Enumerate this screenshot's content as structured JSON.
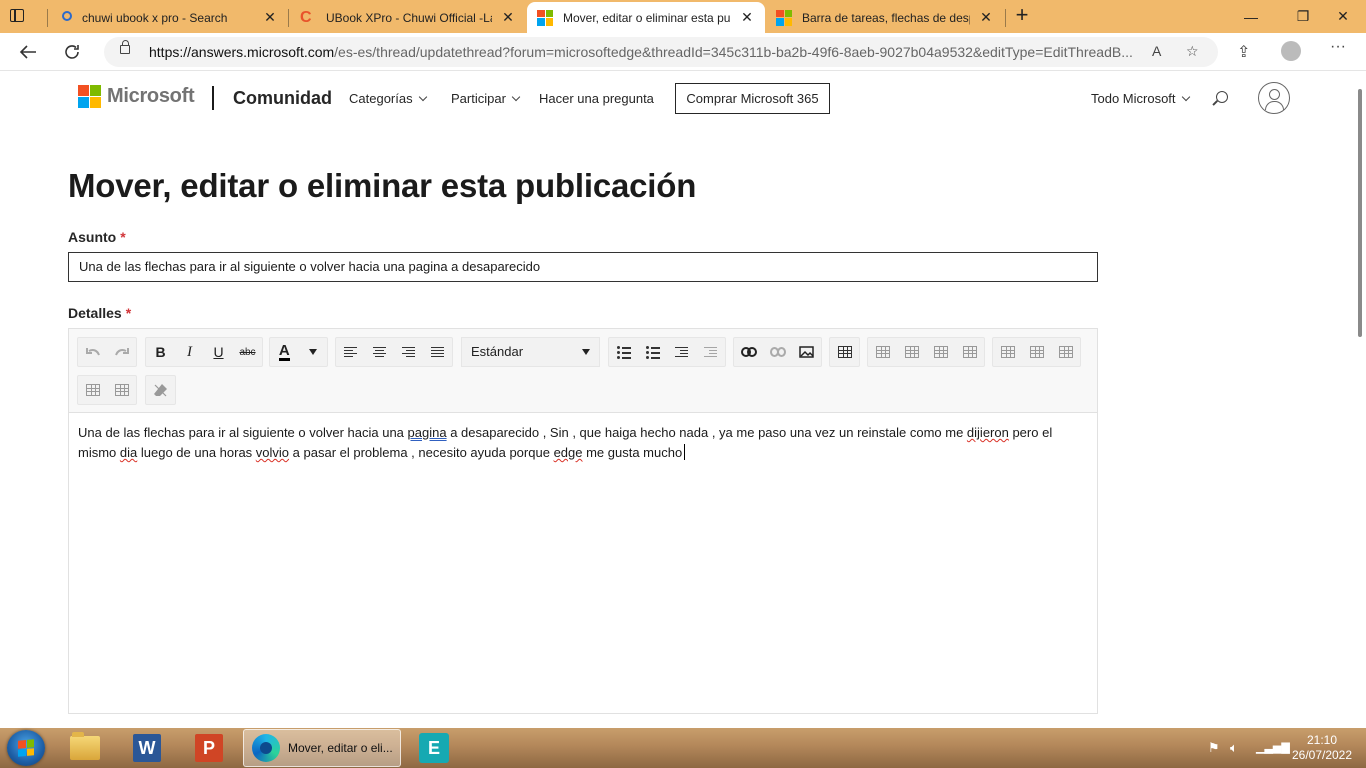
{
  "browser": {
    "tabs": [
      {
        "title": "chuwi ubook x pro - Search",
        "icon": "search-icon"
      },
      {
        "title": "UBook XPro - Chuwi Official -Lap",
        "icon": "chuwi-icon"
      },
      {
        "title": "Mover, editar o eliminar esta pub",
        "icon": "microsoft-logo-icon",
        "active": true
      },
      {
        "title": "Barra de tareas, flechas de despl",
        "icon": "microsoft-logo-icon"
      }
    ],
    "url_host": "https://answers.microsoft.com",
    "url_rest": "/es-es/thread/updatethread?forum=microsoftedge&threadId=345c311b-ba2b-49f6-8aeb-9027b04a9532&editType=EditThreadB...",
    "read_aloud": "A",
    "window_controls": {
      "minimize": "—",
      "restore": "❐",
      "close": "✕"
    }
  },
  "header": {
    "brand": "Microsoft",
    "community": "Comunidad",
    "nav": {
      "categorias": "Categorías",
      "participar": "Participar",
      "hacer_pregunta": "Hacer una pregunta"
    },
    "buy_button": "Comprar Microsoft 365",
    "all_microsoft": "Todo Microsoft"
  },
  "form": {
    "page_title": "Mover, editar o eliminar esta publicación",
    "subject_label": "Asunto",
    "details_label": "Detalles",
    "required_mark": "*",
    "subject_value": "Una de las flechas para ir al siguiente o volver hacia una pagina a desaparecido",
    "font_select": "Estándar",
    "toolbar": {
      "bold": "B",
      "italic": "I",
      "underline": "U",
      "strike": "abc",
      "font_color": "A"
    },
    "body": {
      "p1": "Una de las flechas para ir al siguiente o volver hacia una ",
      "w_pagina": "pagina",
      "p2": " a desaparecido , Sin , que haiga hecho nada , ya me paso una vez un reinstale como me ",
      "w_dijieron": "dijieron",
      "p3": " pero el mismo ",
      "w_dia": "dia",
      "p4": " luego de una horas ",
      "w_volvio": "volvio",
      "p5": " a pasar el problema , necesito ayuda porque ",
      "w_edge": "edge",
      "p6": " me gusta mucho"
    }
  },
  "taskbar": {
    "active_window": "Mover, editar o eli...",
    "word_letter": "W",
    "ppt_letter": "P",
    "evernote_letter": "E",
    "time": "21:10",
    "date": "26/07/2022"
  }
}
